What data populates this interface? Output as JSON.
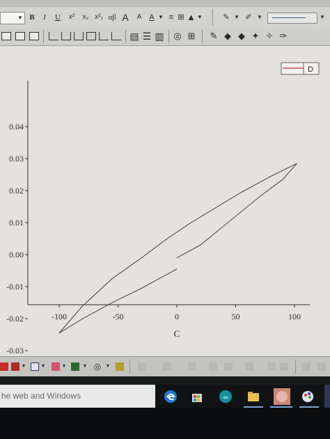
{
  "toolbar": {
    "bold": "B",
    "italic": "I",
    "underline": "U",
    "superscript": "x²",
    "subscript": "x₂",
    "supersub": "x²₁",
    "greek": "αβ",
    "increase_font": "A",
    "decrease_font": "A",
    "font_color": "A"
  },
  "legend": {
    "label": "D",
    "line_color": "#c0303a"
  },
  "taskbar": {
    "search_text": "he web and Windows"
  },
  "chart_data": {
    "type": "line",
    "title": "",
    "xlabel": "C",
    "ylabel": "",
    "xlim": [
      -105,
      110
    ],
    "ylim": [
      -0.03,
      0.04
    ],
    "x_ticks": [
      -100,
      -50,
      0,
      50,
      100
    ],
    "x_tick_labels": [
      "-100",
      "-50",
      "0",
      "50",
      "100"
    ],
    "y_ticks": [
      0.04,
      0.03,
      0.02,
      0.01,
      0.0,
      -0.01,
      -0.02,
      -0.03
    ],
    "y_tick_labels": [
      "0.04",
      "0.03",
      "0.02",
      "0.01",
      "0.00",
      "-0.01",
      "-0.02",
      "-0.03"
    ],
    "series": [
      {
        "legend": "D",
        "upper_branch": {
          "x": [
            102,
            80,
            55,
            30,
            10,
            -10,
            -30,
            -55,
            -80,
            -100
          ],
          "y": [
            0.0285,
            0.0245,
            0.0195,
            0.014,
            0.0095,
            0.0045,
            -0.001,
            -0.0075,
            -0.016,
            -0.0245
          ]
        },
        "lower_branch": {
          "x": [
            -100,
            -80,
            -55,
            -30,
            -10,
            0
          ],
          "y": [
            -0.0245,
            -0.02,
            -0.015,
            -0.0105,
            -0.0065,
            -0.0045
          ]
        },
        "return_branch": {
          "x": [
            0,
            20,
            45,
            70,
            90,
            102
          ],
          "y": [
            -0.001,
            0.003,
            0.0105,
            0.018,
            0.0235,
            0.0285
          ]
        }
      }
    ]
  }
}
